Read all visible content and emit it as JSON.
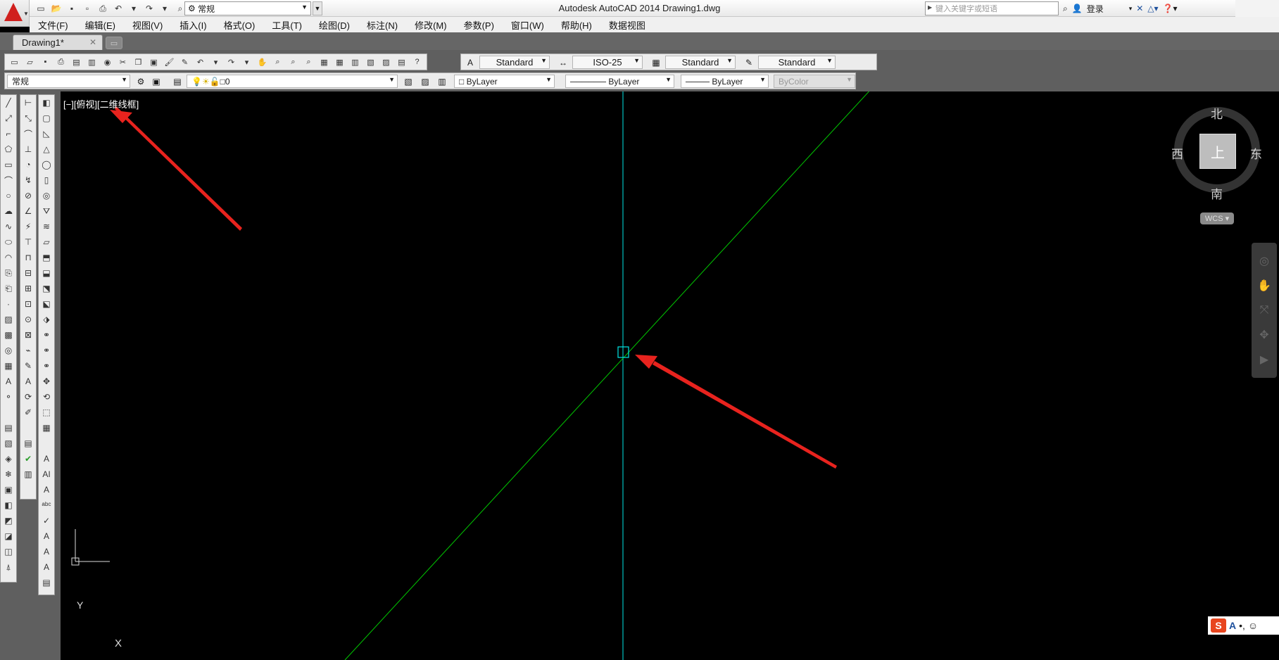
{
  "window": {
    "title": "Autodesk AutoCAD 2014    Drawing1.dwg"
  },
  "workspace": {
    "value": "常规"
  },
  "search": {
    "placeholder": "键入关键字或短语"
  },
  "account": {
    "login": "登录"
  },
  "menu": [
    "文件(F)",
    "编辑(E)",
    "视图(V)",
    "插入(I)",
    "格式(O)",
    "工具(T)",
    "绘图(D)",
    "标注(N)",
    "修改(M)",
    "参数(P)",
    "窗口(W)",
    "帮助(H)",
    "数据视图"
  ],
  "tabs": {
    "active": "Drawing1*"
  },
  "styles": {
    "text_style": "Standard",
    "dim_style": "ISO-25",
    "table_style": "Standard",
    "mleader_style": "Standard"
  },
  "props": {
    "workspace2": "常规",
    "layer": "0",
    "color": "ByLayer",
    "linetype": "ByLayer",
    "lineweight": "ByLayer",
    "plotstyle": "ByColor"
  },
  "viewport": {
    "label": "[−][俯视][二维线框]"
  },
  "viewcube": {
    "north": "北",
    "south": "南",
    "east": "东",
    "west": "西",
    "face": "上",
    "wcs": "WCS"
  },
  "ucs": {
    "x": "X",
    "y": "Y"
  },
  "colors": {
    "xline_green": "#00c800",
    "xline_cyan": "#00e5e5",
    "arrow_red": "#e8231e"
  }
}
